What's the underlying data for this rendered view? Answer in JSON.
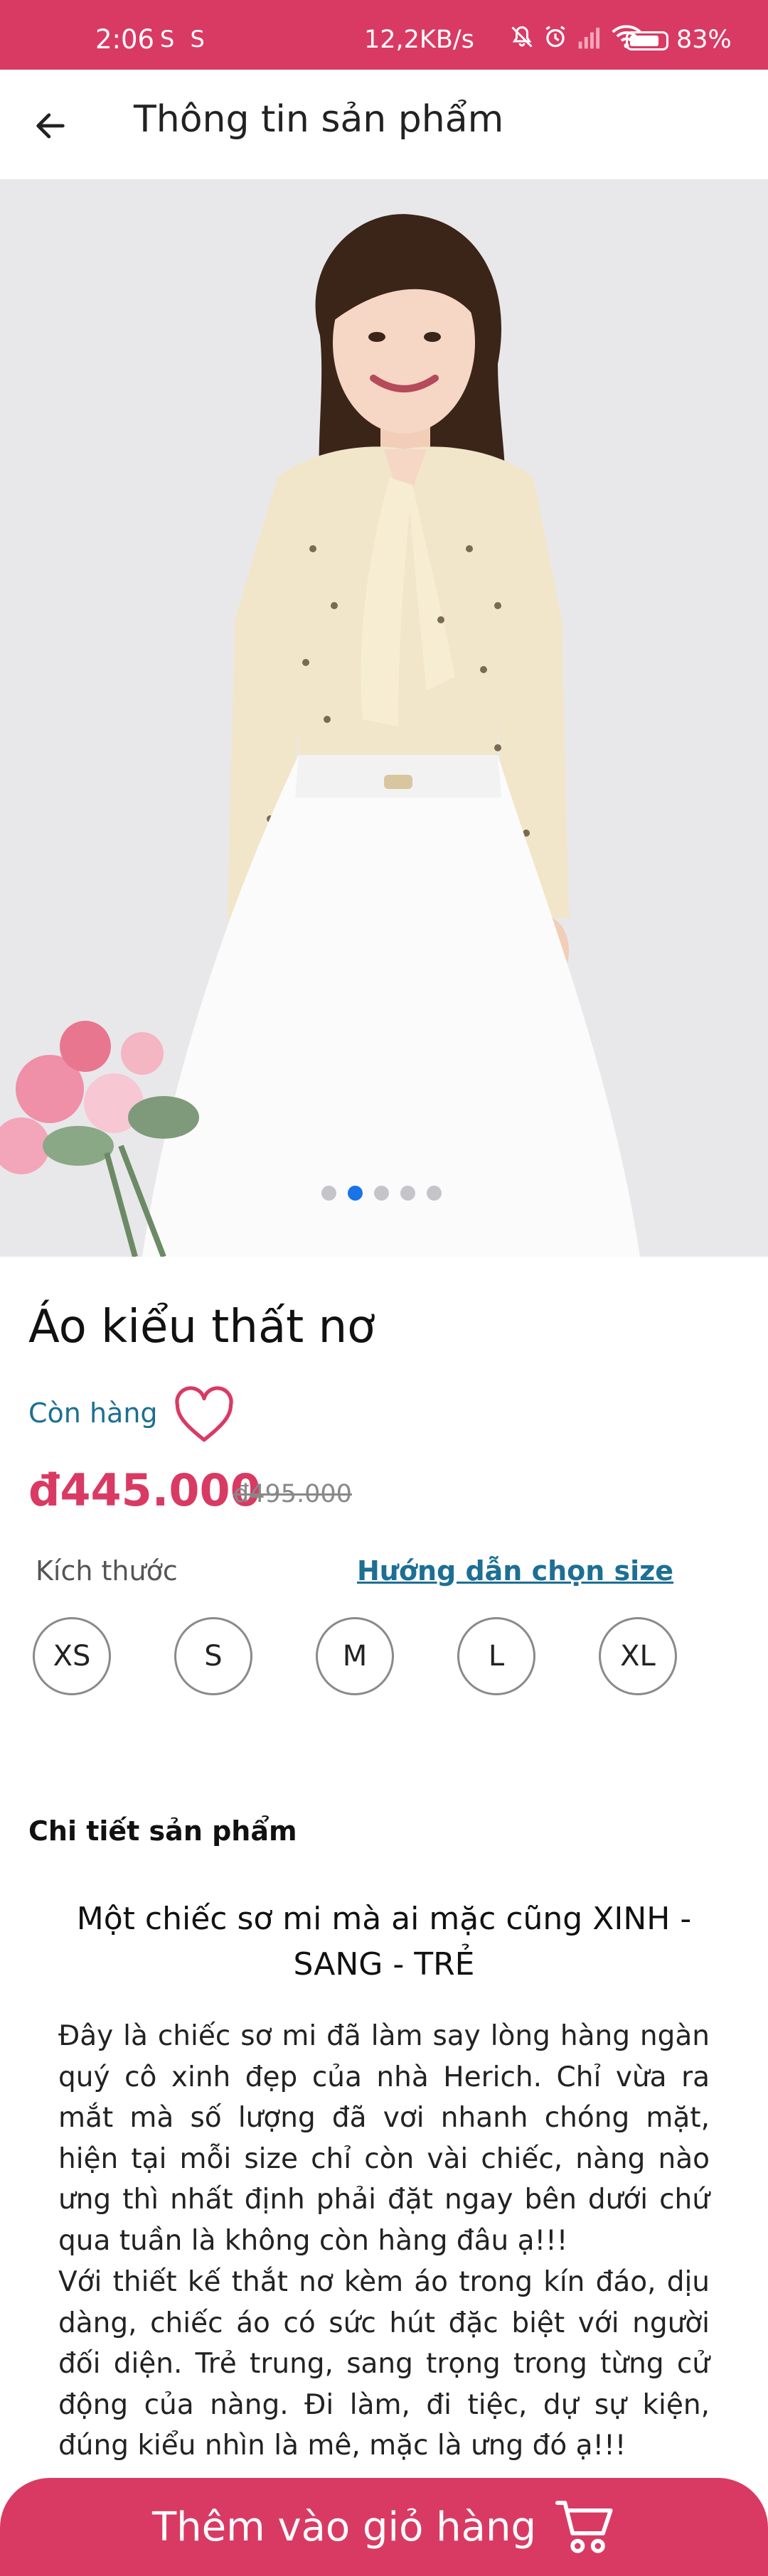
{
  "status_bar": {
    "time": "2:06",
    "left_notifications": "S S",
    "net_speed": "12,2KB/s",
    "battery_percent": "83%"
  },
  "header": {
    "title": "Thông tin sản phẩm",
    "back_icon": "arrow-left-icon"
  },
  "gallery": {
    "image_count": 5,
    "active_index": 1
  },
  "product": {
    "name": "Áo kiểu thất nơ",
    "stock_status": "Còn hàng",
    "price": "đ445.000",
    "old_price": "đ495.000",
    "favorite_icon": "heart-icon"
  },
  "size": {
    "label": "Kích thước",
    "guide_link": "Hướng dẫn chọn size",
    "options": [
      "XS",
      "S",
      "M",
      "L",
      "XL"
    ]
  },
  "details": {
    "label": "Chi tiết sản phẩm",
    "heading": "Một chiếc sơ mi mà ai mặc cũng XINH - SANG - TRẺ",
    "paragraph1": "Đây là chiếc sơ mi đã làm say lòng hàng ngàn quý cô xinh đẹp của nhà Herich. Chỉ vừa ra mắt mà số lượng đã vơi nhanh chóng mặt, hiện tại mỗi size chỉ còn vài chiếc, nàng nào ưng thì nhất định phải đặt ngay bên dưới chứ qua tuần là không còn hàng đâu ạ!!!",
    "paragraph2": "Với thiết kế thắt nơ kèm áo trong kín đáo, dịu dàng, chiếc áo có sức hút đặc biệt với người đối diện. Trẻ trung, sang trọng trong từng cử động của nàng. Đi làm, đi tiệc, dự sự kiện, đúng kiểu nhìn là mê, mặc là ưng đó ạ!!!"
  },
  "cart_button": {
    "label": "Thêm vào giỏ hàng",
    "icon": "shopping-cart-icon"
  },
  "colors": {
    "brand": "#d93a63",
    "link": "#1d6f93",
    "pager_active": "#1a73e8"
  }
}
